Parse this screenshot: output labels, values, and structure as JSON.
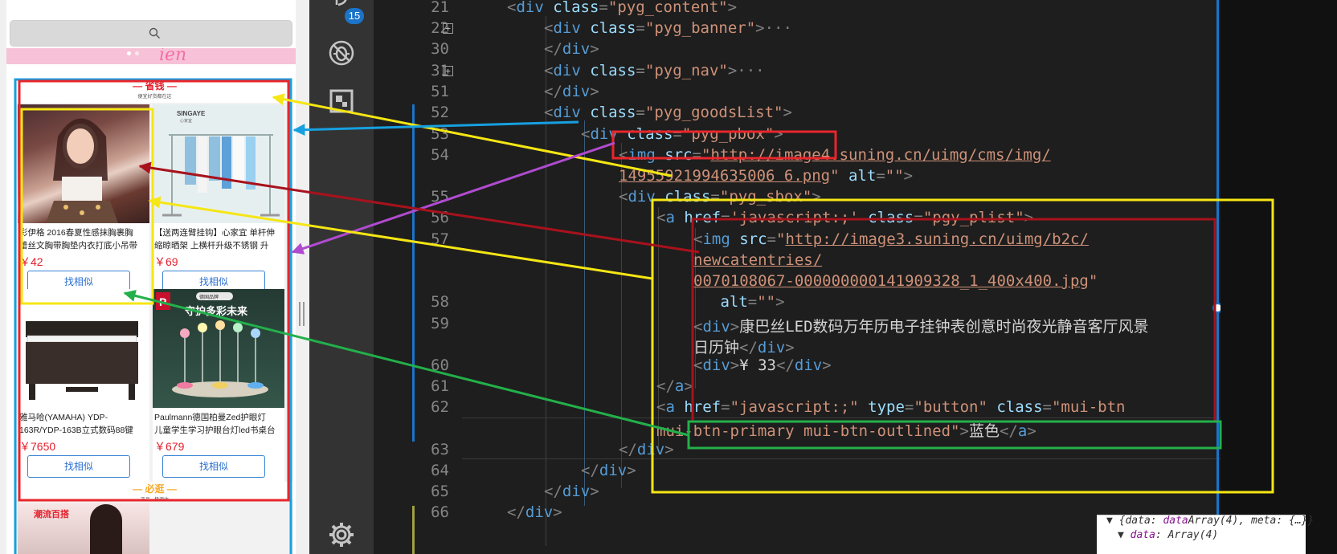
{
  "phone": {
    "banner_script": "ien",
    "section_top": {
      "title": "— 省钱 —",
      "subtitle": "便宜好货都在这"
    },
    "products": [
      {
        "name": "彩伊格 2016春夏性感抹胸裹胸",
        "name2": "蕾丝文胸带胸垫内衣打底小吊带",
        "price": "￥42",
        "button": "找相似"
      },
      {
        "name": "【送两连臂挂钩】心家宜 单杆伸",
        "name2": "缩晾晒架 上横杆升级不锈钢 升",
        "price": "￥69",
        "button": "找相似"
      },
      {
        "name": "雅马哈(YAMAHA) YDP-",
        "name2": "163R/YDP-163B立式数码88键",
        "price": "￥7650",
        "button": "找相似"
      },
      {
        "name": "Paulmann德国柏曼Zed护眼灯",
        "name2": "儿童学生学习护眼台灯led书桌台",
        "price": "￥679",
        "button": "找相似"
      }
    ],
    "product_tags": {
      "brand1": "SINGAYE",
      "brand1_sub": "心家宜",
      "lamp_slogan": "守护多彩未来",
      "lamp_badge": "德国品牌",
      "lamp_logo": "P"
    },
    "section_bottom": {
      "title": "— 必逛 —",
      "subtitle": "正品 · 极速达",
      "peek_label": "潮流百搭"
    }
  },
  "activity": {
    "badge": "15"
  },
  "editor": {
    "lines": [
      {
        "n": "21",
        "fold": false
      },
      {
        "n": "22",
        "fold": true
      },
      {
        "n": "30",
        "fold": false
      },
      {
        "n": "31",
        "fold": true
      },
      {
        "n": "51",
        "fold": false
      },
      {
        "n": "52",
        "fold": false
      },
      {
        "n": "53",
        "fold": false
      },
      {
        "n": "54",
        "fold": false
      },
      {
        "n": "55",
        "fold": false
      },
      {
        "n": "56",
        "fold": false
      },
      {
        "n": "57",
        "fold": false
      },
      {
        "n": "58",
        "fold": false
      },
      {
        "n": "59",
        "fold": false
      },
      {
        "n": "60",
        "fold": false
      },
      {
        "n": "61",
        "fold": false
      },
      {
        "n": "62",
        "fold": false
      },
      {
        "n": "63",
        "fold": false
      },
      {
        "n": "64",
        "fold": false
      },
      {
        "n": "65",
        "fold": false
      },
      {
        "n": "66",
        "fold": false
      }
    ],
    "code": {
      "l21": [
        "<",
        "div",
        " class",
        "=",
        "\"pyg_content\"",
        ">"
      ],
      "l22": [
        "<",
        "div",
        " class",
        "=",
        "\"pyg_banner\"",
        ">",
        "···"
      ],
      "l30": [
        "</",
        "div",
        ">"
      ],
      "l31": [
        "<",
        "div",
        " class",
        "=",
        "\"pyg_nav\"",
        ">",
        "···"
      ],
      "l51": [
        "</",
        "div",
        ">"
      ],
      "l52": [
        "<",
        "div",
        " class",
        "=",
        "\"pyg_goodsList\"",
        ">"
      ],
      "l53": [
        "<",
        "div",
        " class",
        "=",
        "\"pyg_pbox\"",
        ">"
      ],
      "l54a": [
        "<",
        "img",
        " src",
        "=",
        "\"",
        "http://image4.suning.cn/uimg/cms/img/"
      ],
      "l54b": [
        "14955921994635006 6.png",
        "\"",
        " alt",
        "=",
        "\"\"",
        ">"
      ],
      "l55": [
        "<",
        "div",
        " class",
        "=",
        "\"pyg_sbox\"",
        ">"
      ],
      "l56": [
        "<",
        "a",
        " href",
        "=",
        "'javascript:;'",
        " class",
        "=",
        "\"pgy_plist\"",
        ">"
      ],
      "l57a": [
        "<",
        "img",
        " src",
        "=",
        "\"",
        "http://image3.suning.cn/uimg/b2c/"
      ],
      "l57b": "newcatentries/",
      "l57c": [
        "0070108067-000000000141909328_1_400x400.jpg",
        "\""
      ],
      "l58": [
        " alt",
        "=",
        "\"\"",
        ">"
      ],
      "l59a": [
        "<",
        "div",
        ">",
        "康巴丝LED数码万年历电子挂钟表创意时尚夜光静音客厅风景"
      ],
      "l59b": [
        "日历钟",
        "</",
        "div",
        ">"
      ],
      "l60": [
        "<",
        "div",
        ">",
        "¥ 33",
        "</",
        "div",
        ">"
      ],
      "l61": [
        "</",
        "a",
        ">"
      ],
      "l62a": [
        "<",
        "a",
        " href",
        "=",
        "\"javascript:;\"",
        " type",
        "=",
        "\"button\"",
        " class",
        "=",
        "\"mui-btn"
      ],
      "l62b": [
        "mui-btn-primary mui-btn-outlined\"",
        ">",
        "蓝色",
        "</",
        "a",
        ">"
      ],
      "l63": [
        "</",
        "div",
        ">"
      ],
      "l64": [
        "</",
        "div",
        ">"
      ],
      "l65": [
        "</",
        "div",
        ">"
      ],
      "l66": [
        "</",
        "div",
        ">"
      ]
    }
  },
  "console": {
    "line1_key": "{data: ",
    "line1_rest": "Array(4), meta: {…}}",
    "line2_key": "data",
    "line2_rest": ": Array(4)"
  },
  "annotation_colors": {
    "red": "#e8262c",
    "yellow": "#f5e614",
    "blue": "#16a0e0",
    "dark_red": "#a8121c",
    "purple": "#b04bd0",
    "green": "#23b04a"
  }
}
